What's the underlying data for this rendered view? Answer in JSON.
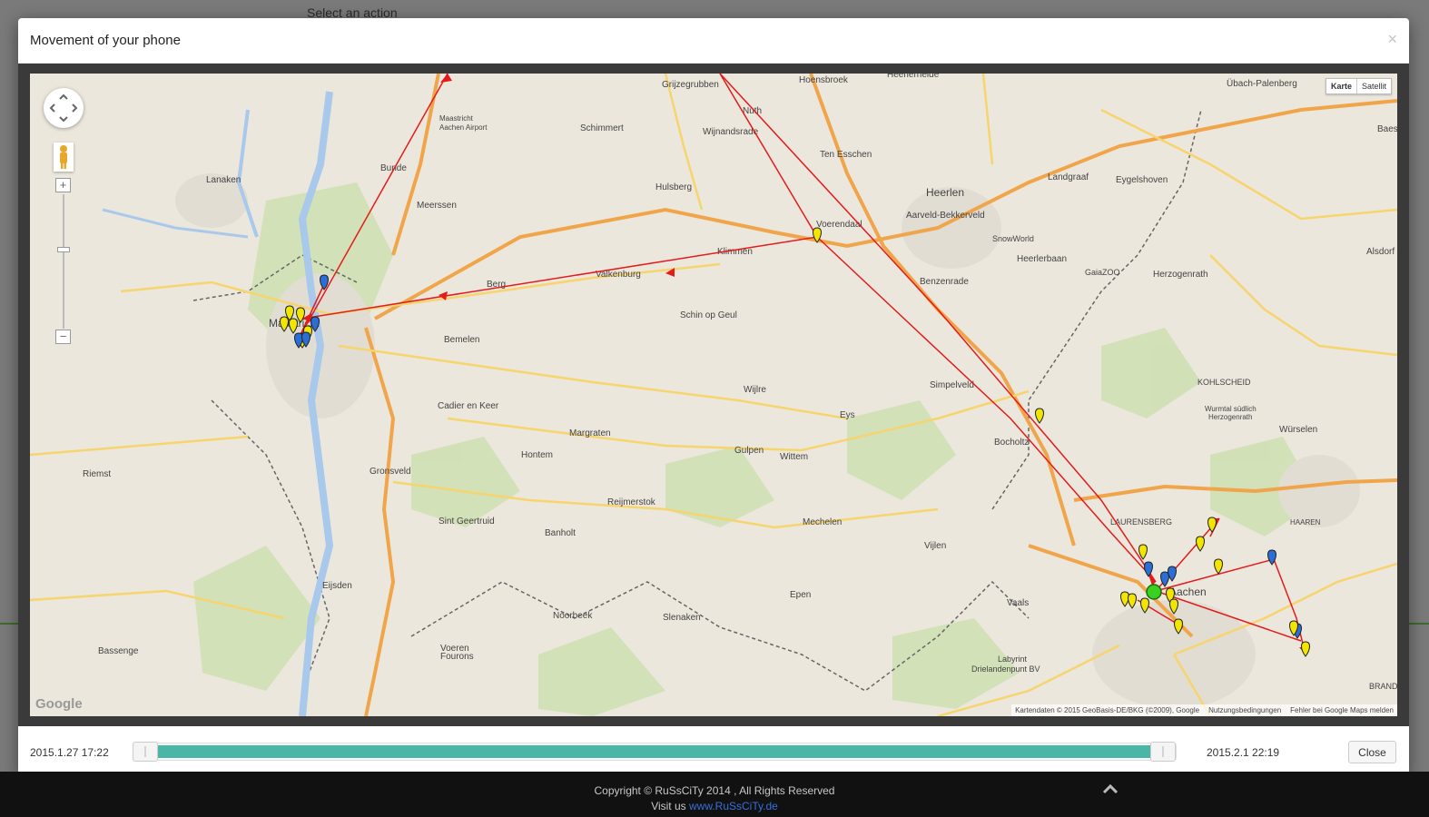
{
  "background": {
    "action_label": "Select an action"
  },
  "modal": {
    "title": "Movement of your phone",
    "close_icon": "close-icon"
  },
  "map": {
    "maptype_buttons": [
      "Karte",
      "Satellit"
    ],
    "active_maptype": "Karte",
    "zoom_in_label": "+",
    "zoom_out_label": "−",
    "logo_text": "Google",
    "attribution": [
      "Kartendaten © 2015 GeoBasis-DE/BKG (©2009), Google",
      "Nutzungsbedingungen",
      "Fehler bei Google Maps melden"
    ],
    "place_labels": [
      "Grijzegrubben",
      "Hoensbroek",
      "Heerlerheide",
      "Übach-Palenberg",
      "Baes",
      "Maastricht Aachen Airport",
      "Schimmert",
      "Nuth",
      "Wijnandsrade",
      "Ten Esschen",
      "Heerlen",
      "Landgraaf",
      "Eygelshoven",
      "Lanaken",
      "Bunde",
      "Meerssen",
      "Hulsberg",
      "Voerendaal",
      "Aarveld-Bekkerveld",
      "SnowWorld",
      "Heerlerbaan",
      "GaiaZOO",
      "Herzogenrath",
      "Alsdorf",
      "Klimmen",
      "Valkenburg",
      "Berg",
      "Benzenrade",
      "Schin op Geul",
      "Maastricht",
      "Bemelen",
      "Kohlscheid",
      "Wurmtal südlich Herzogenrath",
      "Simpelveld",
      "Cadier en Keer",
      "Wijlre",
      "Eys",
      "Bocholtz",
      "Würselen",
      "Margraten",
      "Gulpen",
      "Wittem",
      "Hontem",
      "Riemst",
      "Gronsveld",
      "Reijmerstok",
      "Sint Geertruid",
      "Banholt",
      "Mechelen",
      "Vijlen",
      "Laurensberg",
      "Haaren",
      "Aachen",
      "Eijsden",
      "Noorbeek",
      "Slenaken",
      "Epen",
      "Vaals",
      "Bassenge",
      "Voeren Fourons",
      "Labyrint Drielandenpunt BV",
      "Brand"
    ],
    "marker_colors": {
      "yellow": "#f2e600",
      "blue": "#2b6fd6",
      "green": "#39d11f",
      "route": "#e31b1b"
    }
  },
  "timeline": {
    "start_time": "2015.1.27 17:22",
    "end_time": "2015.2.1 22:19",
    "range_start_fraction": 0.0,
    "range_end_fraction": 1.0,
    "close_label": "Close"
  },
  "footer": {
    "copyright": "Copyright © RuSsCiTy 2014 , All Rights Reserved",
    "visit_prefix": "Visit us",
    "visit_link": "www.RuSsCiTy.de",
    "up_icon": "chevron-up-icon"
  }
}
